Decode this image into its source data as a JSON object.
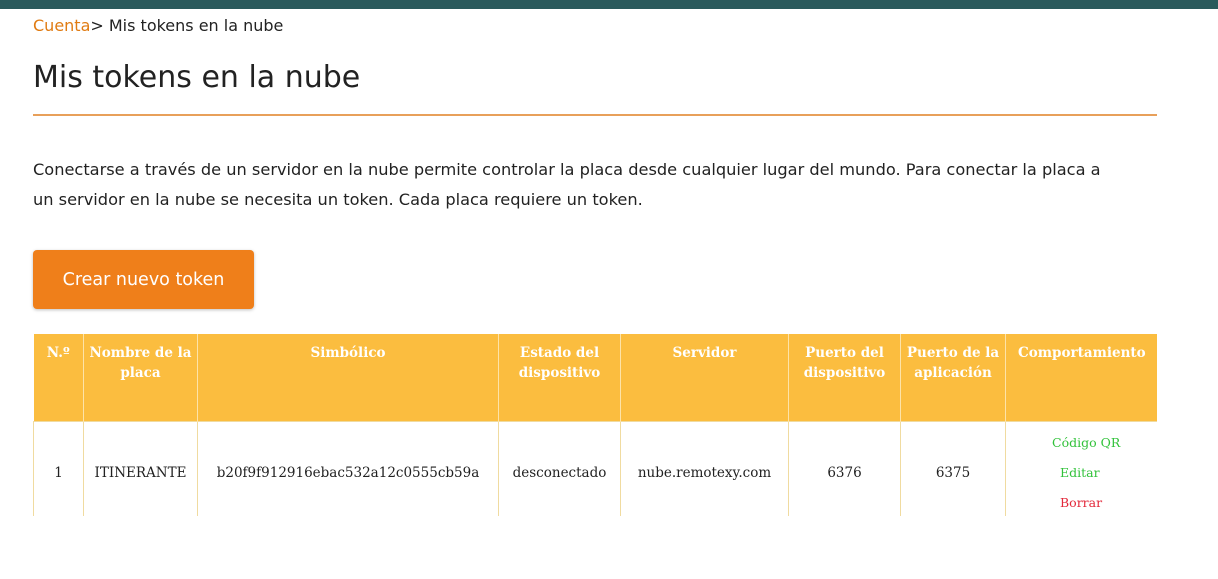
{
  "breadcrumb": {
    "link": "Cuenta",
    "separator": ">",
    "current": " Mis tokens en la nube"
  },
  "page": {
    "title": "Mis tokens en la nube",
    "description": "Conectarse a través de un servidor en la nube permite controlar la placa desde cualquier lugar del mundo. Para conectar la placa a un servidor en la nube se necesita un token. Cada placa requiere un token.",
    "create_button": "Crear nuevo token"
  },
  "table": {
    "headers": [
      "N.º",
      "Nombre de la placa",
      "Simbólico",
      "Estado del dispositivo",
      "Servidor",
      "Puerto del dispositivo",
      "Puerto de la aplicación",
      "Comportamiento"
    ],
    "rows": [
      {
        "number": "1",
        "board_name": "ITINERANTE",
        "token": "b20f9f912916ebac532a12c0555cb59a",
        "status": "desconectado",
        "server": "nube.remotexy.com",
        "device_port": "6376",
        "app_port": "6375",
        "actions": {
          "qr": "Código QR",
          "edit": "Editar",
          "delete": "Borrar"
        }
      }
    ]
  },
  "colors": {
    "accent": "#ef7f1a",
    "table_header": "#fbbd3f",
    "topbar": "#2b5a5c",
    "action_green": "#31c23a",
    "action_red": "#e3283a"
  }
}
